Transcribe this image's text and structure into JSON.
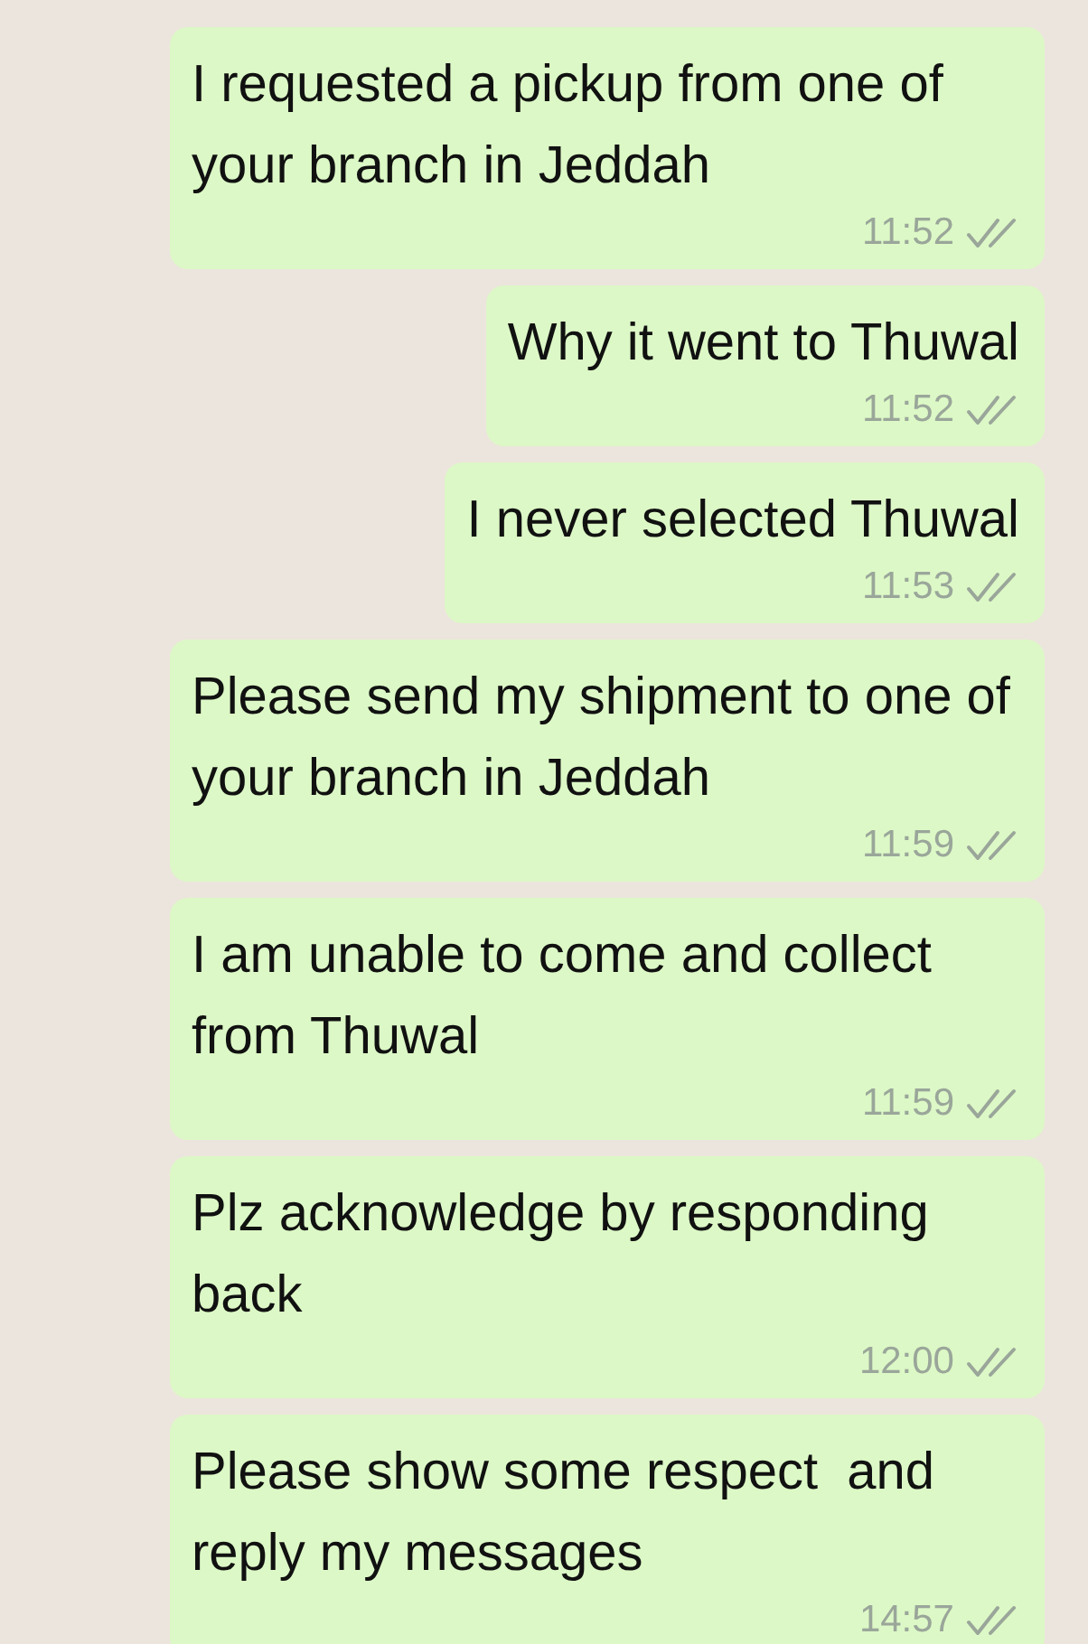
{
  "messages": [
    {
      "text": "I requested a pickup from one of your branch in Jeddah",
      "time": "11:52",
      "read": false
    },
    {
      "text": "Why it went to Thuwal",
      "time": "11:52",
      "read": false
    },
    {
      "text": "I never selected Thuwal",
      "time": "11:53",
      "read": false
    },
    {
      "text": "Please send my shipment to one of your branch in Jeddah",
      "time": "11:59",
      "read": false
    },
    {
      "text": "I am unable to come and collect from Thuwal",
      "time": "11:59",
      "read": false
    },
    {
      "text": "Plz acknowledge by responding back",
      "time": "12:00",
      "read": false
    },
    {
      "text": "Please show some respect  and reply my messages",
      "time": "14:57",
      "read": false
    }
  ]
}
